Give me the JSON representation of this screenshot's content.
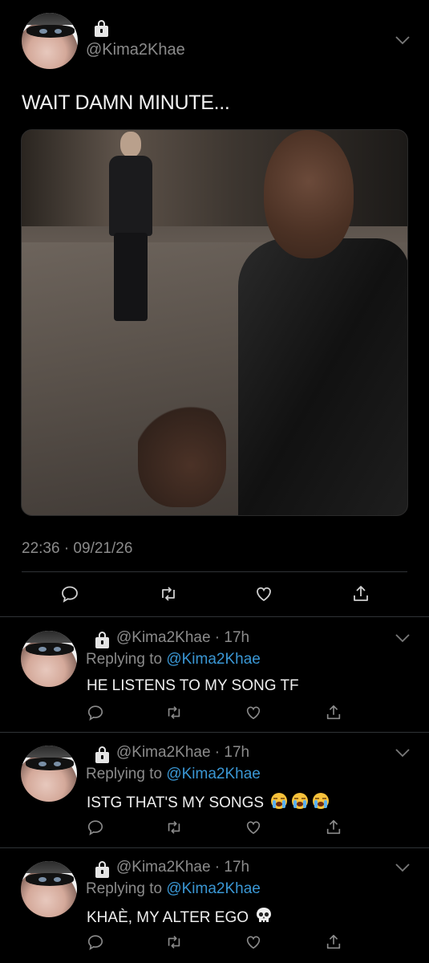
{
  "main_tweet": {
    "handle": "@Kima2Khae",
    "text": "WAIT DAMN MINUTE...",
    "timestamp": "22:36 · 09/21/26",
    "actions": [
      "reply-icon",
      "retweet-icon",
      "like-icon",
      "share-icon"
    ]
  },
  "replies": [
    {
      "handle": "@Kima2Khae",
      "time": "17h",
      "replying_prefix": "Replying to ",
      "replying_to": "@Kima2Khae",
      "text": "HE LISTENS TO MY SONG TF",
      "emojis": []
    },
    {
      "handle": "@Kima2Khae",
      "time": "17h",
      "replying_prefix": "Replying to ",
      "replying_to": "@Kima2Khae",
      "text": "ISTG THAT'S MY SONGS",
      "emojis": [
        "loudly-crying-face",
        "loudly-crying-face",
        "loudly-crying-face"
      ]
    },
    {
      "handle": "@Kima2Khae",
      "time": "17h",
      "replying_prefix": "Replying to ",
      "replying_to": "@Kima2Khae",
      "text": "KHAÈ, MY ALTER EGO",
      "emojis": [
        "skull"
      ]
    }
  ],
  "colors": {
    "background": "#000000",
    "text": "#efefef",
    "muted": "#8b8b8b",
    "link": "#3a97d4",
    "divider": "#2f3336"
  }
}
